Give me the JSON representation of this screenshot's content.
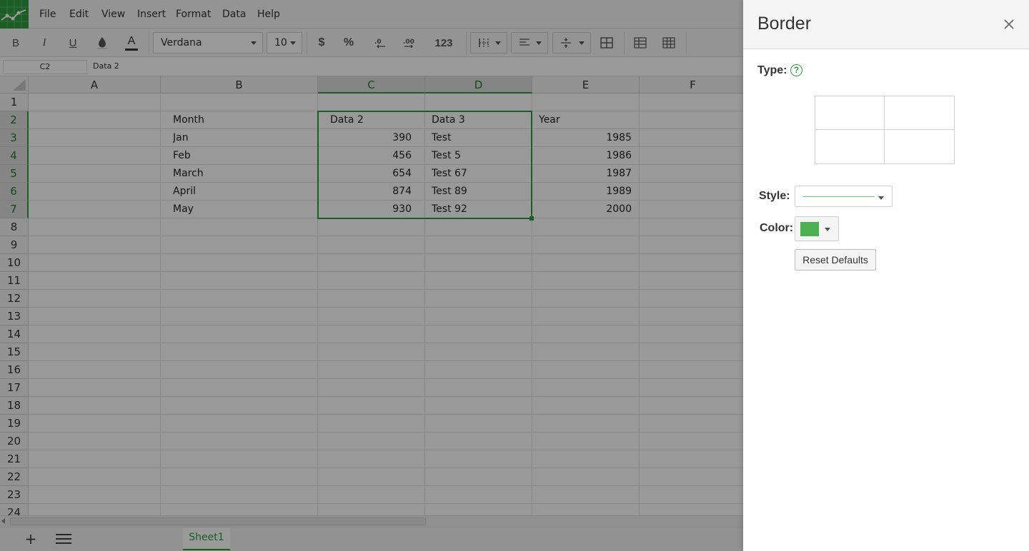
{
  "menubar": {
    "items": [
      "File",
      "Edit",
      "View",
      "Insert",
      "Format",
      "Data",
      "Help"
    ]
  },
  "toolbar": {
    "bold": "B",
    "italic": "I",
    "underline": "U",
    "text_color": "A",
    "font_family": "Verdana",
    "font_size": "10",
    "currency": "$",
    "percent": "%",
    "number_format": "123"
  },
  "formula_bar": {
    "cell_ref": "C2",
    "value": "Data 2"
  },
  "grid": {
    "columns": [
      "A",
      "B",
      "C",
      "D",
      "E",
      "F"
    ],
    "selected_columns": [
      "C",
      "D"
    ],
    "rows": [
      "1",
      "2",
      "3",
      "4",
      "5",
      "6",
      "7",
      "8",
      "9",
      "10",
      "11",
      "12",
      "13",
      "14",
      "15",
      "16",
      "17",
      "18",
      "19",
      "20",
      "21",
      "22",
      "23",
      "24"
    ],
    "selected_rows": [
      "2",
      "3",
      "4",
      "5",
      "6",
      "7"
    ],
    "selected_range": "C2:D7",
    "cells": {
      "B2": "Month",
      "B3": "Jan",
      "B4": "Feb",
      "B5": "March",
      "B6": "April",
      "B7": "May",
      "C2": "Data 2",
      "C3": "390",
      "C4": "456",
      "C5": "654",
      "C6": "874",
      "C7": "930",
      "D2": "Data 3",
      "D3": "Test",
      "D4": "Test 5",
      "D5": "Test 67",
      "D6": "Test 89",
      "D7": "Test 92",
      "E2": "Year",
      "E3": "1985",
      "E4": "1986",
      "E5": "1987",
      "E6": "1989",
      "E7": "2000"
    }
  },
  "sheets": {
    "tabs": [
      "Sheet1"
    ],
    "active": "Sheet1"
  },
  "border_panel": {
    "title": "Border",
    "type_label": "Type:",
    "style_label": "Style:",
    "color_label": "Color:",
    "selected_color": "#4caf50",
    "selected_style": "solid",
    "reset_label": "Reset Defaults"
  },
  "colors": {
    "accent": "#2e9b3e",
    "overlay": "rgba(0,0,0,0.40)"
  }
}
